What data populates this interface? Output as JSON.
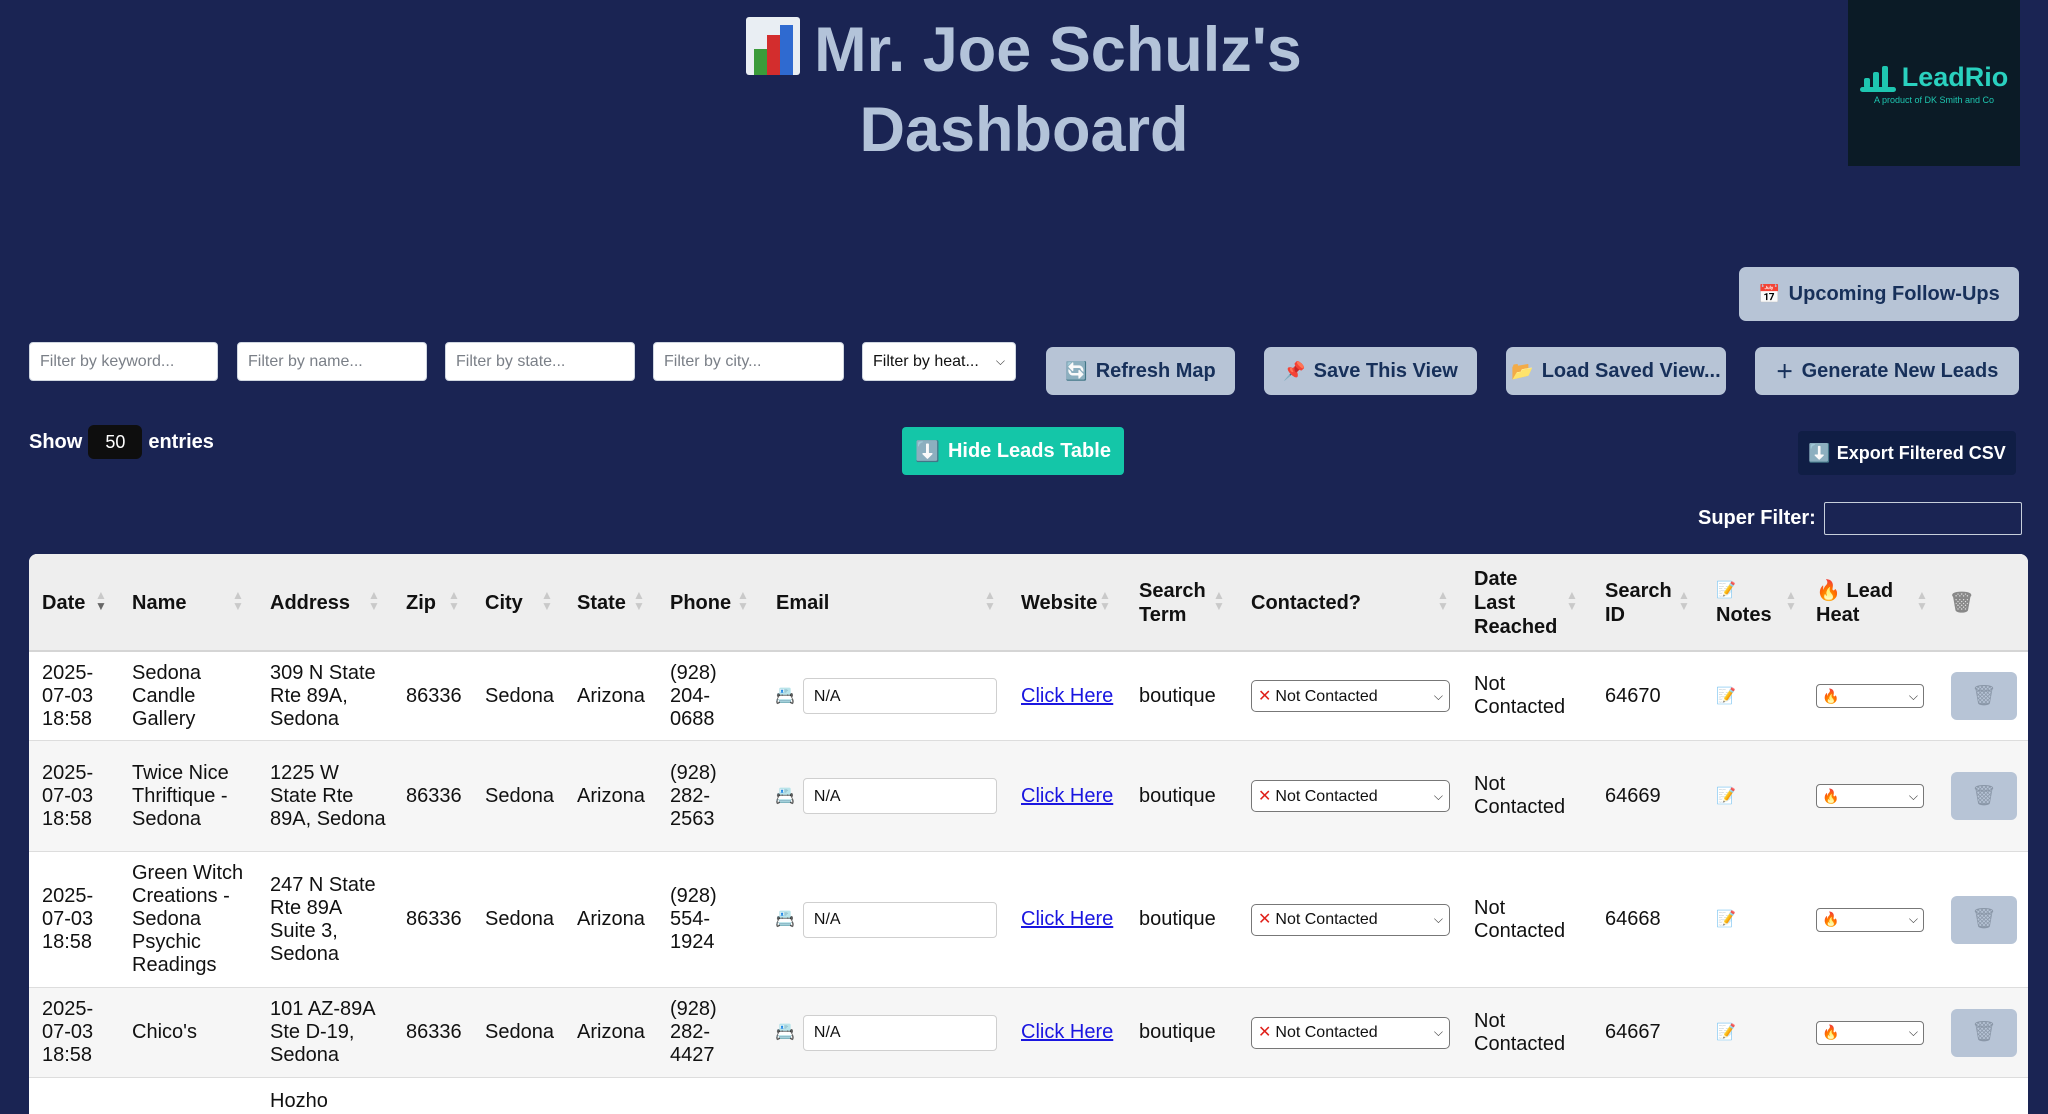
{
  "header": {
    "title_line1": "Mr. Joe Schulz's",
    "title_line2": "Dashboard",
    "icon": "bar-chart-icon"
  },
  "logo": {
    "name": "LeadRio",
    "tagline": "A product of DK Smith and Co"
  },
  "buttons": {
    "followups": "Upcoming Follow-Ups",
    "refresh": "Refresh Map",
    "save_view": "Save This View",
    "load_view": "Load Saved View...",
    "generate": "Generate New Leads",
    "hide_table": "Hide Leads Table",
    "export": "Export Filtered CSV"
  },
  "filters": {
    "keyword": "Filter by keyword...",
    "name": "Filter by name...",
    "state": "Filter by state...",
    "city": "Filter by city...",
    "heat": "Filter by heat..."
  },
  "show": {
    "prefix": "Show",
    "value": "50",
    "suffix": "entries"
  },
  "super_filter": {
    "label": "Super Filter:",
    "value": ""
  },
  "columns": {
    "date": "Date",
    "name": "Name",
    "address": "Address",
    "zip": "Zip",
    "city": "City",
    "state": "State",
    "phone": "Phone",
    "email": "Email",
    "website": "Website",
    "search_term": "Search Term",
    "contacted": "Contacted?",
    "date_last": "Date Last Reached",
    "search_id": "Search ID",
    "notes": "Notes",
    "lead_heat": "Lead Heat"
  },
  "rows": [
    {
      "date": "2025-07-03 18:58",
      "name": "Sedona Candle Gallery",
      "address": "309 N State Rte 89A, Sedona",
      "zip": "86336",
      "city": "Sedona",
      "state": "Arizona",
      "phone": "(928) 204-0688",
      "email": "N/A",
      "website": "Click Here",
      "term": "boutique",
      "contacted": "Not Contacted",
      "last": "Not Contacted",
      "search_id": "64670"
    },
    {
      "date": "2025-07-03 18:58",
      "name": "Twice Nice Thriftique - Sedona",
      "address": "1225 W State Rte 89A, Sedona",
      "zip": "86336",
      "city": "Sedona",
      "state": "Arizona",
      "phone": "(928) 282-2563",
      "email": "N/A",
      "website": "Click Here",
      "term": "boutique",
      "contacted": "Not Contacted",
      "last": "Not Contacted",
      "search_id": "64669"
    },
    {
      "date": "2025-07-03 18:58",
      "name": "Green Witch Creations - Sedona Psychic Readings",
      "address": "247 N State Rte 89A Suite 3, Sedona",
      "zip": "86336",
      "city": "Sedona",
      "state": "Arizona",
      "phone": "(928) 554-1924",
      "email": "N/A",
      "website": "Click Here",
      "term": "boutique",
      "contacted": "Not Contacted",
      "last": "Not Contacted",
      "search_id": "64668"
    },
    {
      "date": "2025-07-03 18:58",
      "name": "Chico's",
      "address": "101 AZ-89A Ste D-19, Sedona",
      "zip": "86336",
      "city": "Sedona",
      "state": "Arizona",
      "phone": "(928) 282-4427",
      "email": "N/A",
      "website": "Click Here",
      "term": "boutique",
      "contacted": "Not Contacted",
      "last": "Not Contacted",
      "search_id": "64667"
    },
    {
      "address": "Hozho"
    }
  ],
  "colors": {
    "background": "#1a2453",
    "accent": "#14c6a8",
    "button": "#b7c4d6"
  }
}
